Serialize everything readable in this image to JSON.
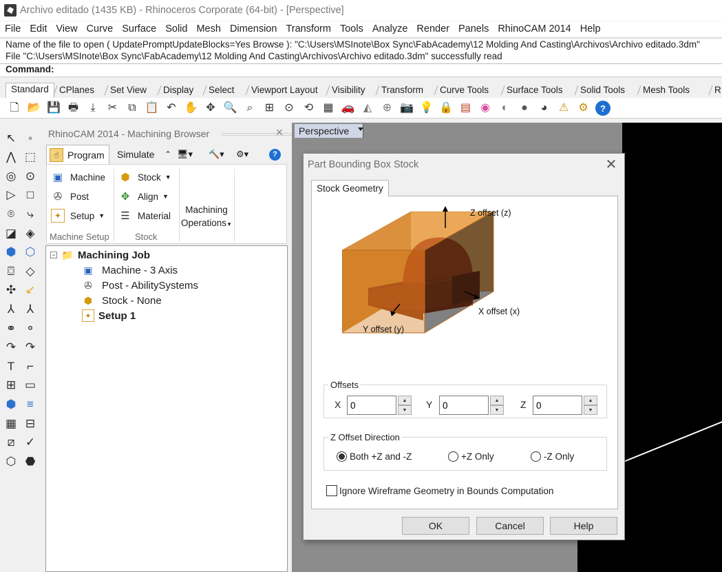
{
  "window": {
    "title": "Archivo editado (1435 KB) - Rhinoceros Corporate (64-bit) - [Perspective]"
  },
  "menu": [
    "File",
    "Edit",
    "View",
    "Curve",
    "Surface",
    "Solid",
    "Mesh",
    "Dimension",
    "Transform",
    "Tools",
    "Analyze",
    "Render",
    "Panels",
    "RhinoCAM 2014",
    "Help"
  ],
  "command_history": [
    "Name of the file to open ( UpdatePromptUpdateBlocks=Yes  Browse ): \"C:\\Users\\MSInote\\Box Sync\\FabAcademy\\12 Molding And Casting\\Archivos\\Archivo editado.3dm\"",
    "File \"C:\\Users\\MSInote\\Box Sync\\FabAcademy\\12 Molding And Casting\\Archivos\\Archivo editado.3dm\" successfully read"
  ],
  "command_prompt": "Command:",
  "toolbar_tabs": [
    "Standard",
    "CPlanes",
    "Set View",
    "Display",
    "Select",
    "Viewport Layout",
    "Visibility",
    "Transform",
    "Curve Tools",
    "Surface Tools",
    "Solid Tools",
    "Mesh Tools",
    "R"
  ],
  "toolbar_icons": [
    "new-file-icon",
    "open-folder-icon",
    "save-icon",
    "print-icon",
    "import-icon",
    "cut-icon",
    "copy-icon",
    "paste-icon",
    "undo-icon",
    "pan-hand-icon",
    "rotate-view-icon",
    "zoom-icon",
    "zoom-window-icon",
    "zoom-extents-icon",
    "zoom-selected-icon",
    "undo-view-icon",
    "four-viewports-icon",
    "car-icon",
    "named-view-icon",
    "construction-plane-icon",
    "camera-icon",
    "light-bulb-icon",
    "lock-icon",
    "layer-icon",
    "color-wheel-icon",
    "wireframe-icon",
    "shaded-icon",
    "rendered-icon",
    "render-settings-icon",
    "options-gear-icon",
    "help-icon"
  ],
  "browser": {
    "title": "RhinoCAM 2014 - Machining Browser",
    "tabs": {
      "program": "Program",
      "simulate": "Simulate"
    },
    "ribbon": {
      "machine": "Machine",
      "post": "Post",
      "setup": "Setup",
      "stock": "Stock",
      "align": "Align",
      "material": "Material",
      "machining_ops_1": "Machining",
      "machining_ops_2": "Operations",
      "group_machine_setup": "Machine Setup",
      "group_stock": "Stock"
    },
    "tree": {
      "root": "Machining Job",
      "machine": "Machine - 3 Axis",
      "post": "Post - AbilitySystems",
      "stock": "Stock - None",
      "setup": "Setup 1"
    }
  },
  "viewport": {
    "label": "Perspective"
  },
  "dialog": {
    "title": "Part Bounding Box Stock",
    "tab": "Stock Geometry",
    "diagram_labels": {
      "z": "Z offset (z)",
      "x": "X offset (x)",
      "y": "Y offset (y)"
    },
    "offsets": {
      "legend": "Offsets",
      "x_label": "X",
      "y_label": "Y",
      "z_label": "Z",
      "x": "0",
      "y": "0",
      "z": "0"
    },
    "z_direction": {
      "legend": "Z Offset Direction",
      "both": "Both +Z and -Z",
      "plus": "+Z Only",
      "minus": "-Z Only",
      "selected": "both"
    },
    "ignore_wireframe": {
      "label": "Ignore Wireframe Geometry in Bounds Computation",
      "checked": false
    },
    "buttons": {
      "ok": "OK",
      "cancel": "Cancel",
      "help": "Help"
    }
  },
  "colors": {
    "stock_box": "#d98a2b",
    "part": "#a33a06",
    "viewport_bg": "#8c8c8c",
    "selected_tab": "#cfd6e6"
  }
}
